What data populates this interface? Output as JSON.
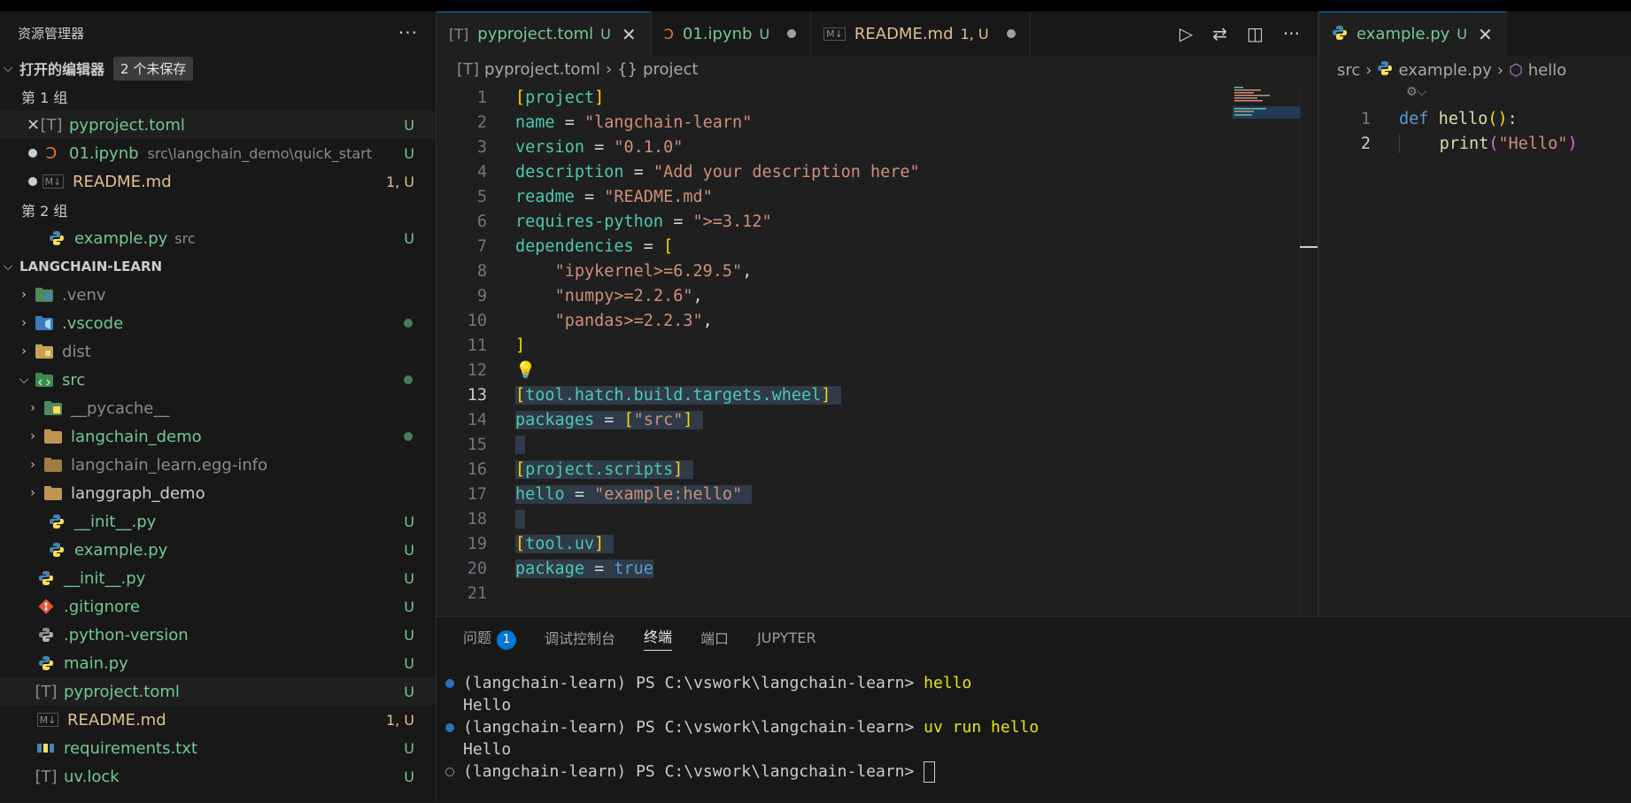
{
  "sidebar": {
    "title": "资源管理器",
    "more_icon": "ellipsis-icon",
    "open_editors": {
      "label": "打开的编辑器",
      "badge": "2 个未保存",
      "group1": "第 1 组",
      "group2": "第 2 组",
      "files": [
        {
          "name": "pyproject.toml",
          "status": "U"
        },
        {
          "name": "01.ipynb",
          "path": "src\\langchain_demo\\quick_start",
          "status": "U"
        },
        {
          "name": "README.md",
          "status": "1, U"
        },
        {
          "name": "example.py",
          "path": "src",
          "status": "U"
        }
      ]
    },
    "project": {
      "label": "LANGCHAIN-LEARN",
      "items": [
        {
          "name": ".venv"
        },
        {
          "name": ".vscode"
        },
        {
          "name": "dist"
        },
        {
          "name": "src"
        },
        {
          "name": "__pycache__"
        },
        {
          "name": "langchain_demo"
        },
        {
          "name": "langchain_learn.egg-info"
        },
        {
          "name": "langgraph_demo"
        },
        {
          "name": "__init__.py",
          "status": "U"
        },
        {
          "name": "example.py",
          "status": "U"
        },
        {
          "name": "__init__.py",
          "status": "U"
        },
        {
          "name": ".gitignore",
          "status": "U"
        },
        {
          "name": ".python-version",
          "status": "U"
        },
        {
          "name": "main.py",
          "status": "U"
        },
        {
          "name": "pyproject.toml",
          "status": "U"
        },
        {
          "name": "README.md",
          "status": "1, U"
        },
        {
          "name": "requirements.txt",
          "status": "U"
        },
        {
          "name": "uv.lock",
          "status": "U"
        }
      ]
    }
  },
  "tabs": [
    {
      "label": "pyproject.toml",
      "mod": "U"
    },
    {
      "label": "01.ipynb",
      "mod": "U"
    },
    {
      "label": "README.md",
      "mod": "1, U"
    }
  ],
  "tabs2": [
    {
      "label": "example.py",
      "mod": "U"
    }
  ],
  "breadcrumb": {
    "file": "pyproject.toml",
    "symbol": "project"
  },
  "breadcrumb2": {
    "folder": "src",
    "file": "example.py",
    "symbol": "hello"
  },
  "code": {
    "lines": [
      "1",
      "2",
      "3",
      "4",
      "5",
      "6",
      "7",
      "8",
      "9",
      "10",
      "11",
      "12",
      "13",
      "14",
      "15",
      "16",
      "17",
      "18",
      "19",
      "20",
      "21"
    ],
    "t": {
      "project_h": "project",
      "name_k": "name",
      "name_v": "\"langchain-learn\"",
      "version_k": "version",
      "version_v": "\"0.1.0\"",
      "desc_k": "description",
      "desc_v": "\"Add your description here\"",
      "readme_k": "readme",
      "readme_v": "\"README.md\"",
      "req_k": "requires-python",
      "req_v": "\">=3.12\"",
      "deps_k": "dependencies",
      "dep1": "\"ipykernel>=6.29.5\"",
      "dep2": "\"numpy>=2.2.6\"",
      "dep3": "\"pandas>=2.2.3\"",
      "hatch_h": "tool.hatch.build.targets.wheel",
      "packages_k": "packages",
      "packages_v": "\"src\"",
      "scripts_h": "project.scripts",
      "hello_k": "hello",
      "hello_v": "\"example:hello\"",
      "uv_h": "tool.uv",
      "package_k": "package",
      "package_v": "true"
    }
  },
  "code2": {
    "lines": [
      "1",
      "2"
    ],
    "def": "def",
    "fn": "hello",
    "print": "print",
    "str": "\"Hello\""
  },
  "panel": {
    "tabs": [
      "问题",
      "调试控制台",
      "终端",
      "端口",
      "JUPYTER"
    ],
    "problems_count": "1",
    "terminal": [
      {
        "prompt": "(langchain-learn) PS C:\\vswork\\langchain-learn> ",
        "cmd": "hello"
      },
      {
        "out": "Hello"
      },
      {
        "prompt": "(langchain-learn) PS C:\\vswork\\langchain-learn> ",
        "cmd": "uv run hello"
      },
      {
        "out": "Hello"
      },
      {
        "prompt": "(langchain-learn) PS C:\\vswork\\langchain-learn> ",
        "cmd": ""
      }
    ]
  }
}
